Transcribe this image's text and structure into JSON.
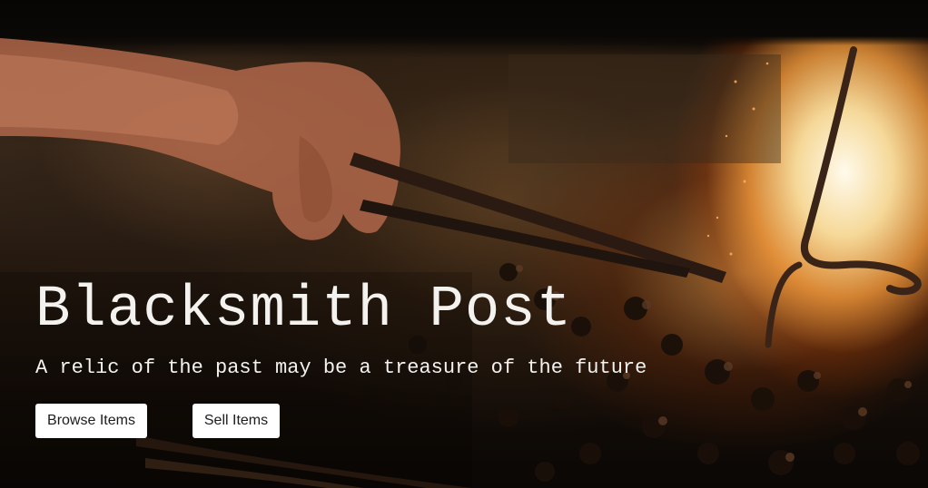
{
  "hero": {
    "title": "Blacksmith Post",
    "tagline": "A relic of the past may be a treasure of the future",
    "background_image": "blacksmith-forge-photo",
    "colors": {
      "text": "#f4f2ee",
      "button_bg": "#ffffff",
      "button_text": "#1c1c1c",
      "fire": "#ffd9a0"
    }
  },
  "actions": {
    "browse_label": "Browse Items",
    "sell_label": "Sell Items"
  }
}
